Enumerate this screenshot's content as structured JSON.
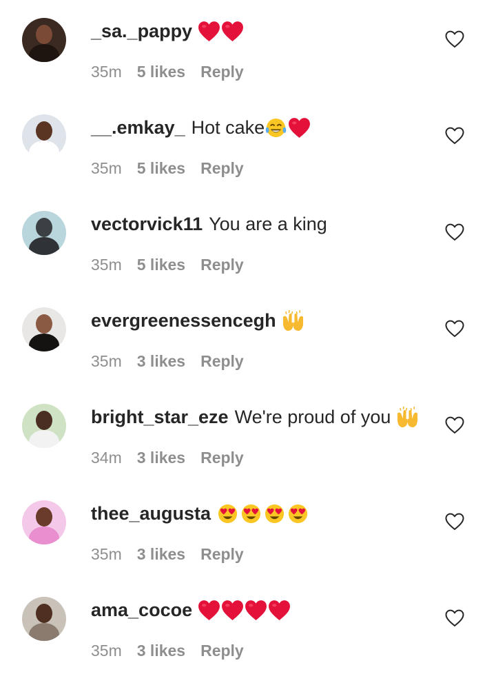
{
  "comments": [
    {
      "username": "_sa._pappy",
      "text": "",
      "emojis": [
        "red-heart",
        "red-heart"
      ],
      "time": "35m",
      "likes": "5 likes",
      "reply": "Reply",
      "avatar": {
        "bg": "#3b2a22",
        "head": "#7a4a36",
        "body": "#1e1410"
      }
    },
    {
      "username": "__.emkay_",
      "text": "Hot cake",
      "emojis": [
        "tears-of-joy",
        "red-heart"
      ],
      "time": "35m",
      "likes": "5 likes",
      "reply": "Reply",
      "avatar": {
        "bg": "#dfe3ea",
        "head": "#5a3524",
        "body": "#ffffff"
      }
    },
    {
      "username": "vectorvick11",
      "text": "You are a king",
      "emojis": [],
      "time": "35m",
      "likes": "5 likes",
      "reply": "Reply",
      "avatar": {
        "bg": "#b9d6dc",
        "head": "#3c3f44",
        "body": "#2f3338"
      }
    },
    {
      "username": "evergreenessencegh",
      "text": "",
      "emojis": [
        "raising-hands"
      ],
      "time": "35m",
      "likes": "3 likes",
      "reply": "Reply",
      "avatar": {
        "bg": "#e9e7e6",
        "head": "#8a5a42",
        "body": "#151212"
      }
    },
    {
      "username": "bright_star_eze",
      "text": "We're proud of you",
      "emojis": [
        "raising-hands"
      ],
      "time": "34m",
      "likes": "3 likes",
      "reply": "Reply",
      "avatar": {
        "bg": "#cfe2c4",
        "head": "#4a2e22",
        "body": "#f2f2f2"
      }
    },
    {
      "username": "thee_augusta",
      "text": "",
      "emojis": [
        "heart-eyes",
        "heart-eyes",
        "heart-eyes",
        "heart-eyes"
      ],
      "time": "35m",
      "likes": "3 likes",
      "reply": "Reply",
      "avatar": {
        "bg": "#f4c8e8",
        "head": "#6a3a2a",
        "body": "#e98fcf"
      }
    },
    {
      "username": "ama_cocoe",
      "text": "",
      "emojis": [
        "red-heart",
        "red-heart",
        "red-heart",
        "red-heart"
      ],
      "time": "35m",
      "likes": "3 likes",
      "reply": "Reply",
      "avatar": {
        "bg": "#c9c2b8",
        "head": "#4e2f22",
        "body": "#8b7b6e"
      }
    }
  ],
  "like_icon": "heart-outline-icon"
}
